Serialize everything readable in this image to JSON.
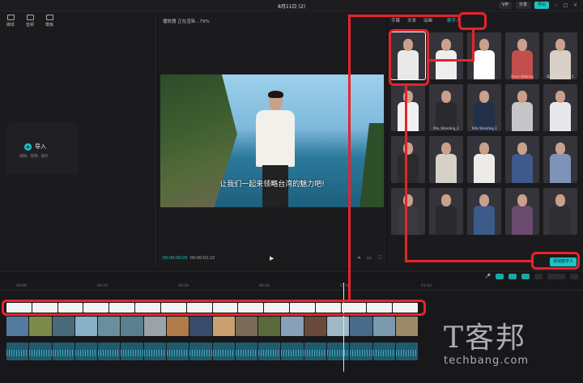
{
  "topbar": {
    "title": "8月11日 (2)",
    "badge_vip": "VIP",
    "share_label": "分享",
    "export_label": "导出"
  },
  "left_panel": {
    "tools": [
      {
        "label": "媒体",
        "icon": "media-icon"
      },
      {
        "label": "音频",
        "icon": "audio-icon"
      },
      {
        "label": "模板",
        "icon": "template-icon"
      }
    ],
    "import_label": "导入",
    "import_sub": "视频、音频、图片"
  },
  "player": {
    "header": "播放器 正在渲染...79%",
    "subtitle": "让我们一起来领略台湾的魅力吧!",
    "time_current": "00:00:00:00",
    "time_total": "00:00:02:22"
  },
  "right_panel": {
    "tabs": [
      "字幕",
      "文本",
      "动画",
      "",
      "数字人"
    ],
    "active_tab": "数字人",
    "avatars": [
      {
        "name": "小明 - 成熟",
        "body": "#e9e9ea"
      },
      {
        "name": "",
        "body": "#eeeeee"
      },
      {
        "name": "",
        "body": "#ffffff"
      },
      {
        "name": "Dove Walking",
        "body": "#c34e4e"
      },
      {
        "name": "Dove Standing 1",
        "body": "#d8d0c6"
      },
      {
        "name": "",
        "body": "#f0f0f0"
      },
      {
        "name": "Mia_Standing_2",
        "body": "#2a2a2e"
      },
      {
        "name": "Tefe-Standing 3",
        "body": "#23304a"
      },
      {
        "name": "",
        "body": "#c6c6c9"
      },
      {
        "name": "",
        "body": "#e8e8ea"
      },
      {
        "name": "",
        "body": "#2b2b2b"
      },
      {
        "name": "",
        "body": "#d5d0c8"
      },
      {
        "name": "",
        "body": "#ecebe8"
      },
      {
        "name": "",
        "body": "#3e5a8a"
      },
      {
        "name": "",
        "body": "#7d93b8"
      },
      {
        "name": "",
        "body": "#3a3a3e"
      },
      {
        "name": "",
        "body": "#2a2a2e"
      },
      {
        "name": "",
        "body": "#3c5b8b"
      },
      {
        "name": "",
        "body": "#6a4a6e"
      },
      {
        "name": "",
        "body": "#2e2e33"
      }
    ],
    "add_button": "添加数字人"
  },
  "timeline": {
    "ruler": [
      "00:00",
      "00:10",
      "00:20",
      "00:30",
      "01:00",
      "01:10"
    ],
    "captions": [
      "",
      "",
      "",
      "",
      "",
      "",
      "",
      "",
      "",
      "",
      "",
      "",
      "",
      "",
      "",
      ""
    ],
    "thumb_colors": [
      "#557aa0",
      "#7d8b4a",
      "#4a6a7a",
      "#8ab0c8",
      "#6a8f9c",
      "#5a8090",
      "#9aa3a8",
      "#b07a4a",
      "#3a4a6a",
      "#caa070",
      "#7a6a5a",
      "#5a6a3a",
      "#8aa0b8",
      "#6a4a3a",
      "#a0b8c8",
      "#4a6a8a",
      "#7a9ab0",
      "#9a8a6a"
    ],
    "audio_segments": 18
  },
  "watermark": {
    "cn": "T客邦",
    "en": "techbang.com"
  }
}
